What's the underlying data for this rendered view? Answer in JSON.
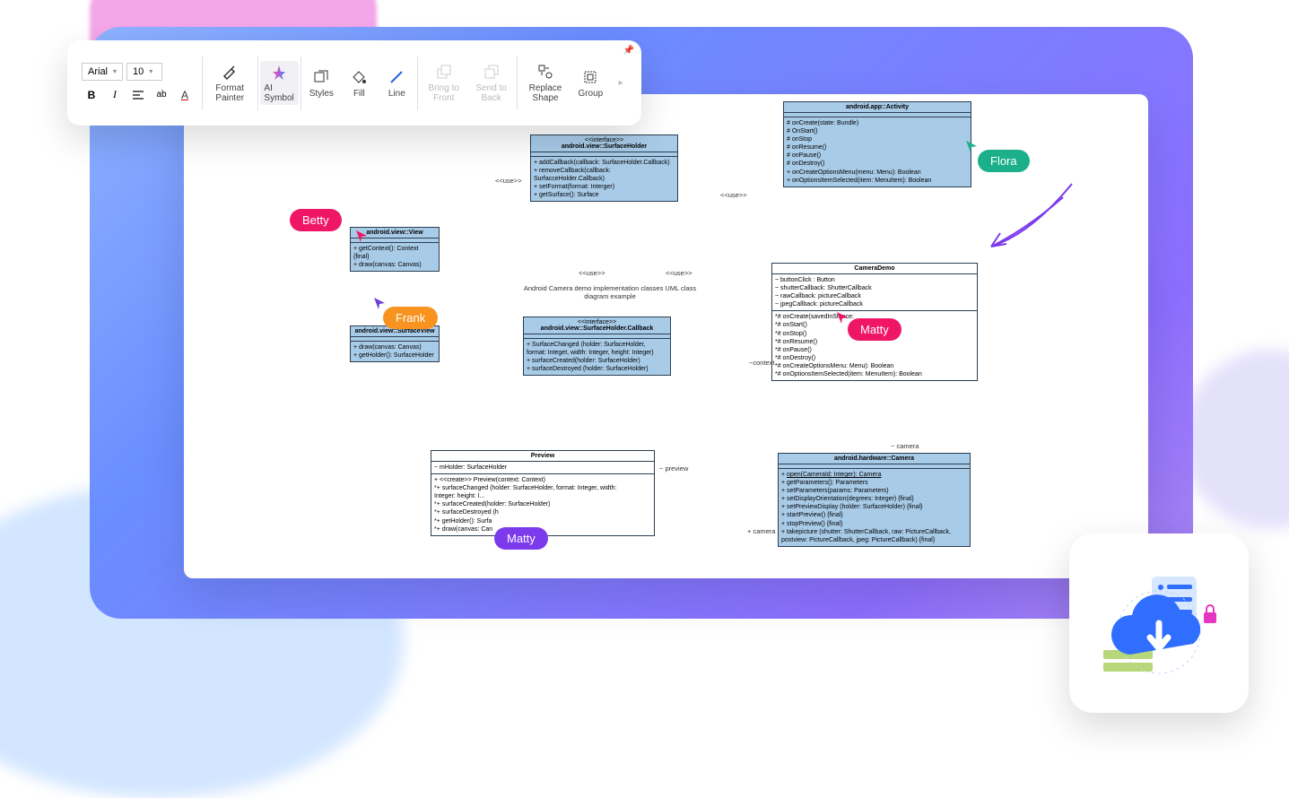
{
  "toolbar": {
    "font": "Arial",
    "size": "10",
    "bold": "B",
    "italic": "I",
    "format_painter": "Format Painter",
    "ai_symbol": "AI Symbol",
    "styles": "Styles",
    "fill": "Fill",
    "line": "Line",
    "bring_to_front": "Bring to Front",
    "send_to_back": "Send to Back",
    "replace_shape": "Replace Shape",
    "group": "Group"
  },
  "cursors": {
    "betty": "Betty",
    "frank": "Frank",
    "matty1": "Matty",
    "matty2": "Matty",
    "flora": "Flora"
  },
  "caption": "Android Camera demo implementation classes UML class diagram example",
  "labels": {
    "use1": "<<use>>",
    "use2": "<<use>>",
    "use3": "<<use>>",
    "use4": "<<use>>",
    "context": "~context",
    "preview": "~ preview",
    "camera1": "+ camera",
    "camera2": "~ camera"
  },
  "boxes": {
    "surfaceholder": {
      "stereo": "<<interface>>",
      "title": "android.view::SurfaceHolder",
      "body": "+ addCallback(callback: SurfaceHolder.Callback)\n+ removeCallback(callback: SurfacceHolder.Callback)\n+ setFormat(format: Interger)\n+ getSurface(): Surface"
    },
    "view": {
      "title": "android.view::View",
      "body": "+ getContext(): Context {final}\n+ draw(canvas: Canvas)"
    },
    "surfaceview": {
      "title": "android.view::SurfaceView",
      "body": "+ draw(canvas: Canvas)\n+ getHolder(): SurfaceHolder"
    },
    "callback": {
      "stereo": "<<interface>>",
      "title": "android.view::SurfaceHolder.Callback",
      "body": "+ SurfaceChanged (holder: SurfaceHolder,\nformat: Integet, width: Integer, height: Integer)\n+ surfaceCreated(holder: SurfaceHolder)\n+ surfaceDestroyed (holder: SurfaceHolder)"
    },
    "activity": {
      "title": "android.app::Activity",
      "body": "# onCreate(state: Bundle)\n# OnStart()\n# onStop\n# onResume()\n# onPause()\n# onDestroy()\n+ onCreateOptionsMenu(menu: Menu): Boolean\n+ onOptionsItemSelected(item: MenuItem): Boolean"
    },
    "camerademo": {
      "title": "CameraDemo",
      "sec1": "~ buttonClick : Button\n~ shutterCallback: ShutterCallback\n~ rawCallback: pictureCallback\n~ jpegCallback: pictureCallback",
      "sec2": "*# onCreate(savedInStance:\n*# onStart()\n*# onStop()\n*# onResume()\n*# onPause()\n*# onDestroy()\n*# onCreateOptionsMenu: Menu): Boolean\n*# onOptionsItemSelected(item: MenuItem): Boolean"
    },
    "preview": {
      "title": "Preview",
      "sec1": "~ mHolder: SurfaceHolder",
      "sec2": "+ <<create>> Preview(context: Context)\n*+ surfaceChanged (holder: SurfaceHolder, format: Integer, width:\nInteger: height: I...\n*+ surfaceCreated(holder: SurfaceHolder)\n*+ surfaceDestroyed (h\n*+ getHolder(): Surfa\n*+ draw(canvas: Can"
    },
    "camera": {
      "title": "android.hardware::Camera",
      "body": "+ open(CameraId: Integer): Camera\n+ getParameters(): Parameters\n+ setParameters(params: Parameters)\n+ setDisplayOrientation(degrees: Integer) {final}\n+ setPreviewDisplay (holder: SurfaceHolder) {final}\n+ startPreview() {final}\n+ stopPreview() {final}\n+ takepicture (shutter: ShutterCallback, raw: PictureCallback,\npostview: PictureCallback, jpeg: PictureCallback) {final}"
    }
  }
}
